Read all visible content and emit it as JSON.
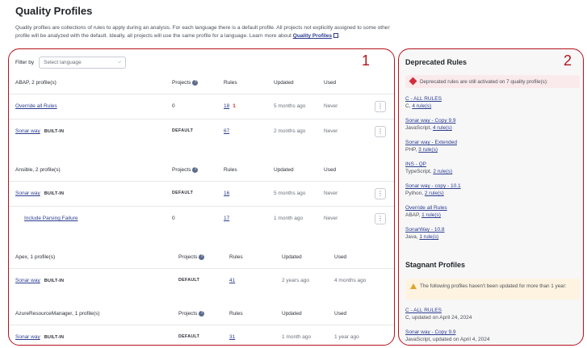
{
  "page": {
    "title": "Quality Profiles",
    "intro": "Quality profiles are collections of rules to apply during an analysis. For each language there is a default profile. All projects not explicitly assigned to some other profile will be analyzed with the default. Ideally, all projects will use the same profile for a language. Learn more about",
    "intro_link": "Quality Profiles",
    "intro_end": "."
  },
  "annotations": {
    "left": "1",
    "right": "2"
  },
  "filter": {
    "label": "Filter by",
    "placeholder": "Select language"
  },
  "columns": {
    "projects": "Projects",
    "rules": "Rules",
    "updated": "Updated",
    "used": "Used"
  },
  "sections": [
    {
      "language": "ABAP, 2 profile(s)",
      "profiles": [
        {
          "name": "Override all Rules",
          "builtin": "",
          "projects": "0",
          "rules": "18",
          "deprecated": "1",
          "updated": "5 months ago",
          "used": "Never"
        },
        {
          "name": "Sonar way",
          "builtin": "BUILT-IN",
          "projects": "DEFAULT",
          "rules": "67",
          "deprecated": "",
          "updated": "2 months ago",
          "used": "Never"
        }
      ]
    },
    {
      "language": "Ansible, 2 profile(s)",
      "profiles": [
        {
          "name": "Sonar way",
          "builtin": "BUILT-IN",
          "projects": "DEFAULT",
          "rules": "16",
          "deprecated": "",
          "updated": "5 months ago",
          "used": "Never"
        },
        {
          "name": "Include Parsing Failure",
          "builtin": "",
          "projects": "0",
          "rules": "17",
          "deprecated": "",
          "updated": "1 month ago",
          "used": "Never"
        }
      ]
    },
    {
      "language": "Apex, 1 profile(s)",
      "profiles": [
        {
          "name": "Sonar way",
          "builtin": "BUILT-IN",
          "projects": "DEFAULT",
          "rules": "41",
          "deprecated": "",
          "updated": "2 years ago",
          "used": "4 months ago"
        }
      ]
    },
    {
      "language": "AzureResourceManager, 1 profile(s)",
      "profiles": [
        {
          "name": "Sonar way",
          "builtin": "BUILT-IN",
          "projects": "DEFAULT",
          "rules": "31",
          "deprecated": "",
          "updated": "1 month ago",
          "used": "1 year ago"
        }
      ]
    }
  ],
  "deprecated": {
    "title": "Deprecated Rules",
    "alert": "Deprecated rules are still activated on 7 quality profile(s):",
    "items": [
      {
        "name": "C - ALL RULES",
        "lang": "C,",
        "rules": "4 rule(s)"
      },
      {
        "name": "Sonar way - Copy 9.9",
        "lang": "JavaScript,",
        "rules": "4 rule(s)"
      },
      {
        "name": "Sonar way - Extended",
        "lang": "PHP,",
        "rules": "3 rule(s)"
      },
      {
        "name": "INS - QP",
        "lang": "TypeScript,",
        "rules": "2 rule(s)"
      },
      {
        "name": "Sonar way - copy - 10.1",
        "lang": "Python,",
        "rules": "2 rule(s)"
      },
      {
        "name": "Override all Rules",
        "lang": "ABAP,",
        "rules": "1 rule(s)"
      },
      {
        "name": "SonarWay - 10.8",
        "lang": "Java,",
        "rules": "1 rule(s)"
      }
    ]
  },
  "stagnant": {
    "title": "Stagnant Profiles",
    "warning": "The following profiles haven't been updated for more than 1 year:",
    "items": [
      {
        "name": "C - ALL RULES",
        "meta": "C, updated on April 24, 2024"
      },
      {
        "name": "Sonar way - Copy 9.9",
        "meta": "JavaScript, updated on April 4, 2024"
      }
    ]
  }
}
